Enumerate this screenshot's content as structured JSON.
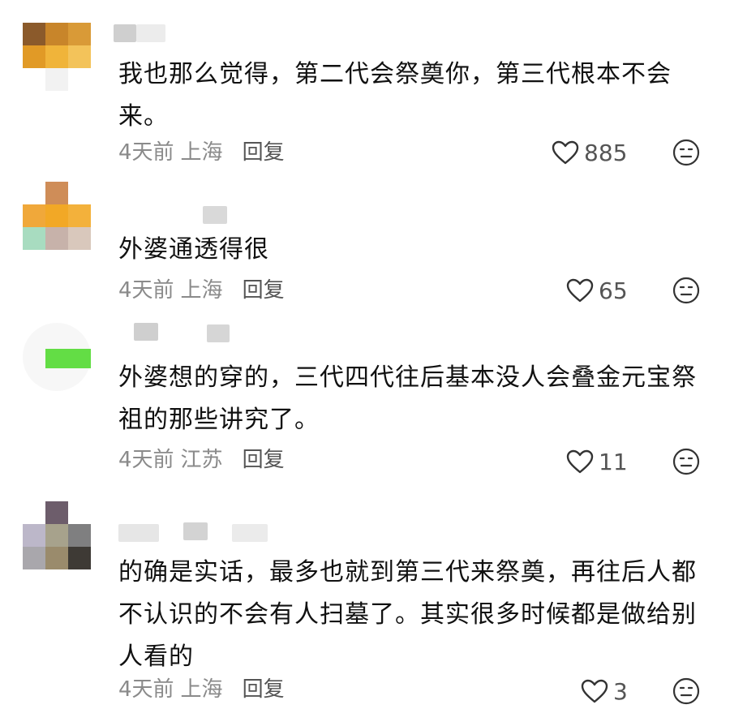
{
  "comments": [
    {
      "text": "我也那么觉得，第二代会祭奠你，第三代根本不会来。",
      "time": "4天前",
      "location": "上海",
      "reply_label": "回复",
      "likes": "885"
    },
    {
      "text": "外婆通透得很",
      "time": "4天前",
      "location": "上海",
      "reply_label": "回复",
      "likes": "65"
    },
    {
      "text": "外婆想的穿的，三代四代往后基本没人会叠金元宝祭祖的那些讲究了。",
      "time": "4天前",
      "location": "江苏",
      "reply_label": "回复",
      "likes": "11"
    },
    {
      "text": "的确是实话，最多也就到第三代来祭奠，再往后人都不认识的不会有人扫墓了。其实很多时候都是做给别人看的",
      "time": "4天前",
      "location": "上海",
      "reply_label": "回复",
      "likes": "3"
    }
  ],
  "icons": {
    "like": "heart-icon",
    "reaction": "face-icon"
  },
  "colors": {
    "meta": "#8a8a8a",
    "text": "#111111",
    "icon": "#333333"
  }
}
